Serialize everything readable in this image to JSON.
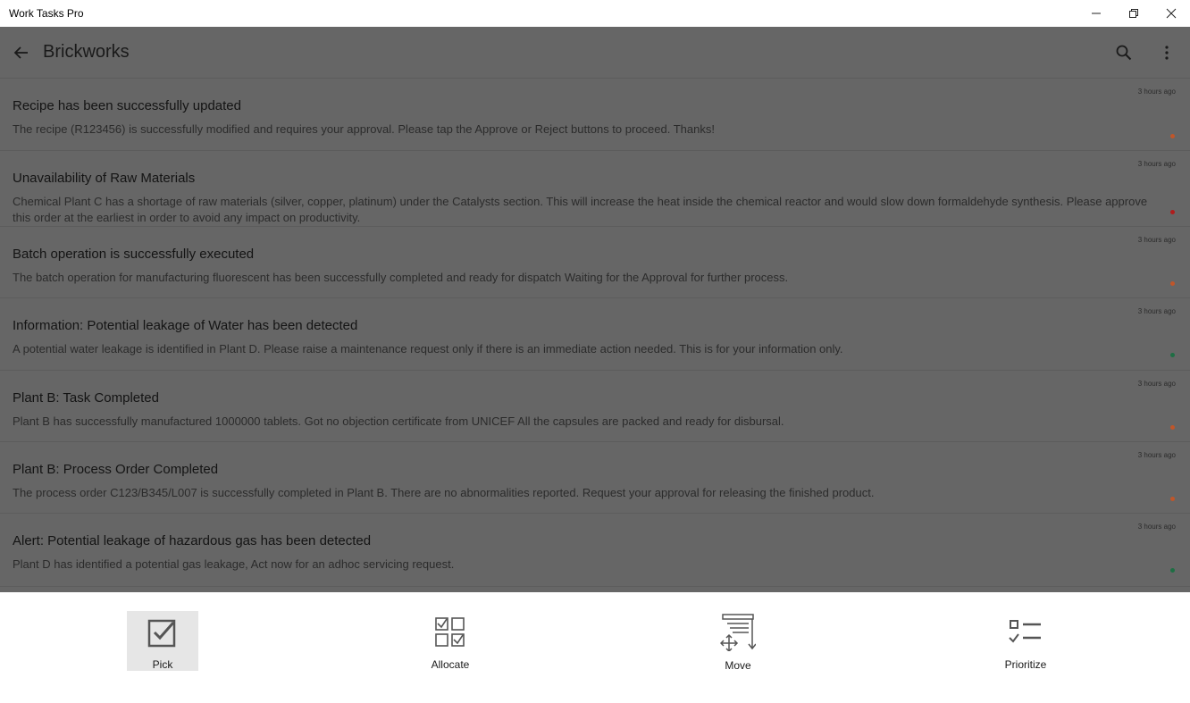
{
  "window": {
    "title": "Work Tasks Pro"
  },
  "header": {
    "title": "Brickworks"
  },
  "icons": {
    "back": "arrow-left-icon",
    "search": "search-icon",
    "menu": "more-vertical-icon"
  },
  "notifications": [
    {
      "title": "Recipe has been successfully updated",
      "body": "The recipe (R123456) is successfully modified and requires your approval. Please tap the Approve or Reject buttons to proceed. Thanks!",
      "time": "3 hours ago",
      "status_color": "#c0562a"
    },
    {
      "title": "Unavailability of Raw Materials",
      "body": "Chemical Plant C has a shortage of raw materials (silver, copper, platinum) under the Catalysts section. This will increase the heat inside the chemical reactor and would slow down formaldehyde synthesis. Please approve this order at the earliest in order to avoid any impact on productivity.",
      "time": "3 hours ago",
      "status_color": "#b01c1c"
    },
    {
      "title": "Batch operation is successfully executed",
      "body": "The batch operation for manufacturing fluorescent has been successfully completed and ready for dispatch Waiting for the Approval for further process.",
      "time": "3 hours ago",
      "status_color": "#c0562a"
    },
    {
      "title": "Information: Potential leakage of Water has been detected",
      "body": "A potential water leakage is identified in Plant D. Please raise a maintenance request only if there is an immediate action needed. This is for your information only.",
      "time": "3 hours ago",
      "status_color": "#1e6e44"
    },
    {
      "title": "Plant B: Task Completed",
      "body": "Plant B has successfully manufactured 1000000 tablets. Got no objection certificate from UNICEF All the capsules are packed and ready for disbursal.",
      "time": "3 hours ago",
      "status_color": "#c0562a"
    },
    {
      "title": "Plant B: Process Order Completed",
      "body": "The process order C123/B345/L007 is successfully completed in Plant B. There are no abnormalities reported. Request your approval for releasing the finished product.",
      "time": "3 hours ago",
      "status_color": "#c0562a"
    },
    {
      "title": "Alert: Potential leakage of hazardous gas has been detected",
      "body": "Plant D has identified a potential gas leakage, Act now for an adhoc servicing request.",
      "time": "3 hours ago",
      "status_color": "#1e6e44"
    }
  ],
  "actions": [
    {
      "label": "Pick",
      "icon": "checkbox-checked-icon",
      "selected": true
    },
    {
      "label": "Allocate",
      "icon": "checklist-grid-icon",
      "selected": false
    },
    {
      "label": "Move",
      "icon": "move-icon",
      "selected": false
    },
    {
      "label": "Prioritize",
      "icon": "prioritize-list-icon",
      "selected": false
    }
  ]
}
